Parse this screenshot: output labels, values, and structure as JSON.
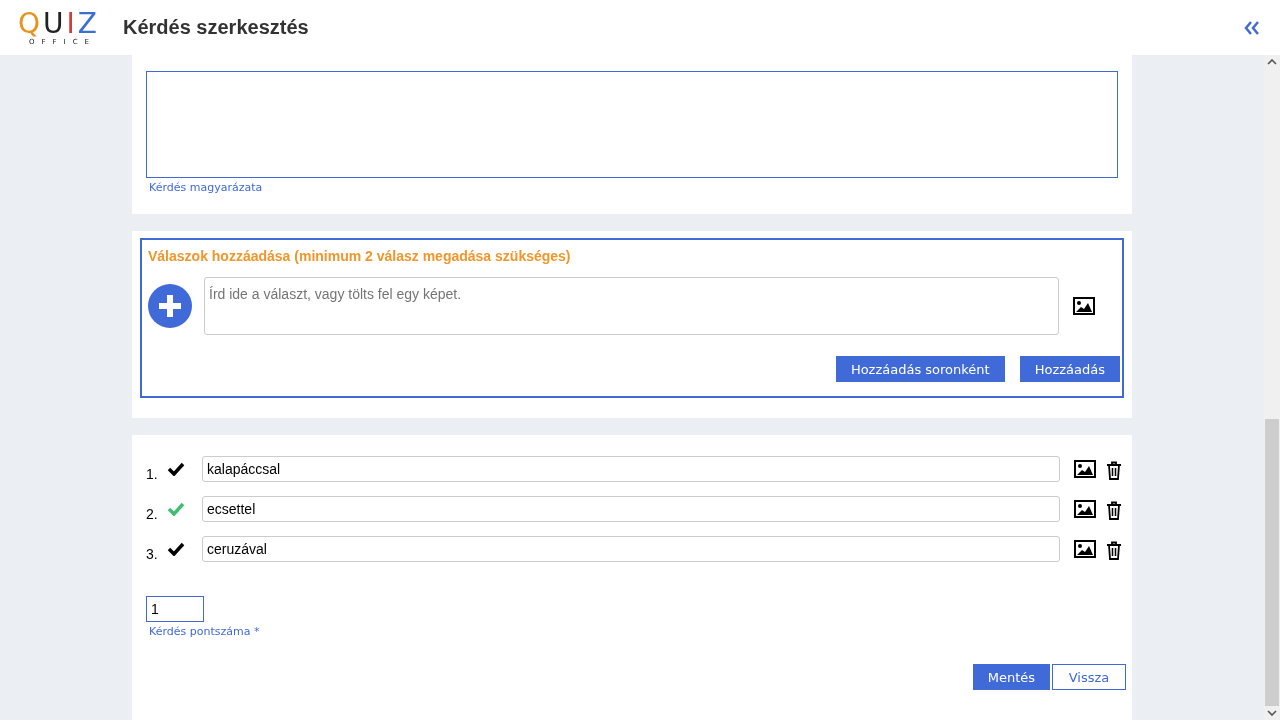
{
  "logo": {
    "word": "QUIZ",
    "sub": "OFFICE"
  },
  "header": {
    "title": "Kérdés szerkesztés"
  },
  "explanation": {
    "label": "Kérdés magyarázata"
  },
  "add_answers": {
    "title": "Válaszok hozzáadása (minimum 2 válasz megadása szükséges)",
    "placeholder": "Írd ide a választ, vagy tölts fel egy képet.",
    "buttons": [
      "Hozzáadás soronként",
      "Hozzáadás"
    ]
  },
  "answers": [
    {
      "number": "1.",
      "value": "kalapáccsal",
      "correct": false
    },
    {
      "number": "2.",
      "value": "ecsettel",
      "correct": true
    },
    {
      "number": "3.",
      "value": "ceruzával",
      "correct": false
    }
  ],
  "points": {
    "value": "1",
    "label": "Kérdés pontszáma *"
  },
  "footer_buttons": [
    {
      "label": "Mentés",
      "kind": "primary"
    },
    {
      "label": "Vissza",
      "kind": "outline"
    }
  ]
}
